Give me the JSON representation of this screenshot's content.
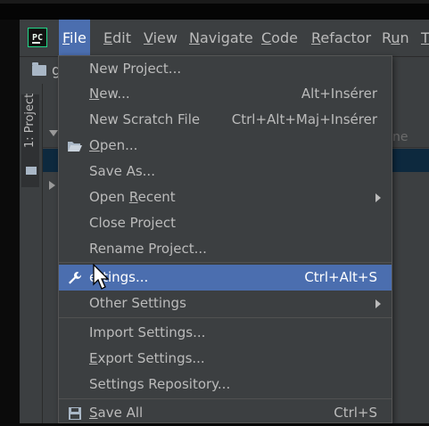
{
  "menubar": {
    "app_logo_text": "PC",
    "items": [
      {
        "pre": "",
        "mn": "F",
        "post": "ile"
      },
      {
        "pre": "",
        "mn": "E",
        "post": "dit"
      },
      {
        "pre": "",
        "mn": "V",
        "post": "iew"
      },
      {
        "pre": "",
        "mn": "N",
        "post": "avigate"
      },
      {
        "pre": "",
        "mn": "C",
        "post": "ode"
      },
      {
        "pre": "",
        "mn": "R",
        "post": "efactor"
      },
      {
        "pre": "R",
        "mn": "u",
        "post": "n"
      },
      {
        "pre": "",
        "mn": "T",
        "post": ""
      }
    ]
  },
  "navbar": {
    "crumb": "g"
  },
  "side": {
    "project_tab_label": "1: Project"
  },
  "pane": {
    "column_text": "ne"
  },
  "file_menu": {
    "items": [
      {
        "label_pre": "New Project...",
        "label_u": "",
        "label_post": "",
        "shortcut": ""
      },
      {
        "label_pre": "",
        "label_u": "N",
        "label_post": "ew...",
        "shortcut": "Alt+Insérer"
      },
      {
        "label_pre": "New Scratch File",
        "label_u": "",
        "label_post": "",
        "shortcut": "Ctrl+Alt+Maj+Insérer"
      },
      {
        "label_pre": "",
        "label_u": "O",
        "label_post": "pen...",
        "shortcut": "",
        "icon": "open-folder-icon"
      },
      {
        "label_pre": "Save As...",
        "label_u": "",
        "label_post": "",
        "shortcut": ""
      },
      {
        "label_pre": "Open ",
        "label_u": "R",
        "label_post": "ecent",
        "shortcut": "",
        "submenu": true
      },
      {
        "label_pre": "Close Project",
        "label_u": "",
        "label_post": "",
        "shortcut": ""
      },
      {
        "label_pre": "Rename Project...",
        "label_u": "",
        "label_post": "",
        "shortcut": ""
      },
      {
        "label_pre": "",
        "label_u": "",
        "label_post": "ettings...",
        "shortcut": "Ctrl+Alt+S",
        "icon": "wrench-icon",
        "highlighted": true
      },
      {
        "label_pre": "Other Settings",
        "label_u": "",
        "label_post": "",
        "shortcut": "",
        "submenu": true
      },
      {
        "label_pre": "Import Settings...",
        "label_u": "",
        "label_post": "",
        "shortcut": ""
      },
      {
        "label_pre": "",
        "label_u": "E",
        "label_post": "xport Settings...",
        "shortcut": ""
      },
      {
        "label_pre": "Settings Repository...",
        "label_u": "",
        "label_post": "",
        "shortcut": ""
      },
      {
        "label_pre": "",
        "label_u": "S",
        "label_post": "ave All",
        "shortcut": "Ctrl+S",
        "icon": "save-icon"
      }
    ]
  },
  "colors": {
    "accent": "#4b6eaf",
    "menu_bg": "#3c3f41",
    "text": "#bbbbbb"
  }
}
